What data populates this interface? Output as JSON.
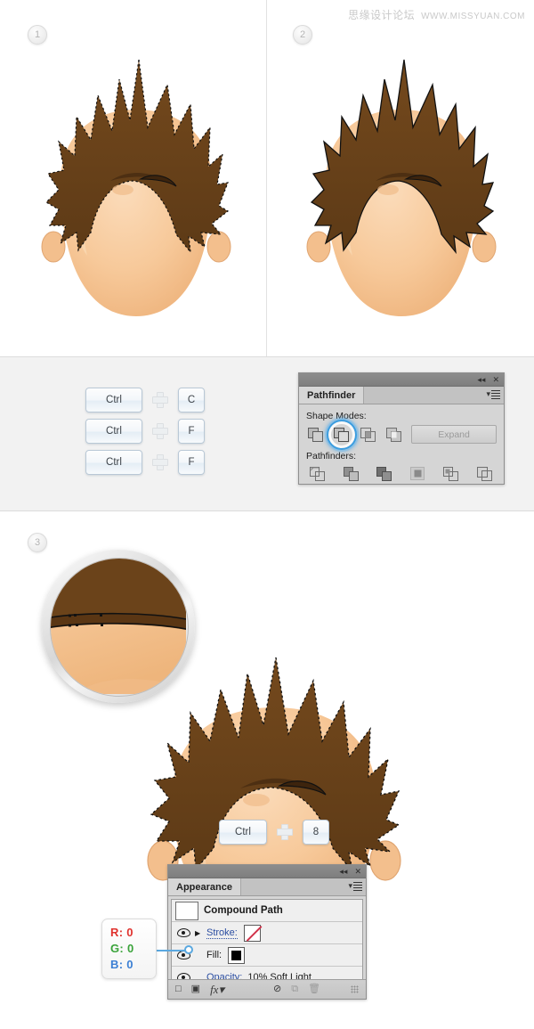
{
  "watermark": {
    "cn": "思缘设计论坛",
    "en": "WWW.MISSYUAN.COM"
  },
  "steps": [
    {
      "id": "1",
      "label": "1"
    },
    {
      "id": "2",
      "label": "2"
    },
    {
      "id": "3",
      "label": "3"
    }
  ],
  "shortcuts": [
    {
      "modifier": "Ctrl",
      "plus": "+",
      "key": "C"
    },
    {
      "modifier": "Ctrl",
      "plus": "+",
      "key": "F"
    },
    {
      "modifier": "Ctrl",
      "plus": "+",
      "key": "F"
    }
  ],
  "shortcut_bottom": {
    "modifier": "Ctrl",
    "plus": "+",
    "key": "8"
  },
  "pathfinder": {
    "tab": "Pathfinder",
    "shape_modes_label": "Shape Modes:",
    "pathfinders_label": "Pathfinders:",
    "expand_label": "Expand",
    "collapse_icon": "collapse-icon",
    "close_icon": "close-icon",
    "menu_icon": "panel-menu-icon",
    "shape_modes": [
      {
        "name": "unite",
        "selected": false
      },
      {
        "name": "minus-front",
        "selected": true
      },
      {
        "name": "intersect",
        "selected": false
      },
      {
        "name": "exclude",
        "selected": false
      }
    ],
    "pathfinder_modes": [
      {
        "name": "divide"
      },
      {
        "name": "trim"
      },
      {
        "name": "merge"
      },
      {
        "name": "crop"
      },
      {
        "name": "outline"
      },
      {
        "name": "minus-back"
      }
    ]
  },
  "appearance": {
    "tab": "Appearance",
    "collapse_icon": "collapse-icon",
    "close_icon": "close-icon",
    "menu_icon": "panel-menu-icon",
    "object_title": "Compound Path",
    "rows": [
      {
        "label": "Stroke:",
        "value": "",
        "swatch": "none",
        "has_eye": true,
        "has_arrow": true
      },
      {
        "label": "Fill:",
        "value": "",
        "swatch": "black",
        "has_eye": true,
        "has_arrow": false
      },
      {
        "label": "Opacity:",
        "value": "10% Soft Light",
        "swatch": "",
        "has_eye": true,
        "has_arrow": false
      }
    ],
    "footer_icons": [
      "new-stroke-icon",
      "new-fill-icon",
      "fx-icon",
      "clear-appearance-icon",
      "duplicate-item-icon",
      "delete-item-icon",
      "resize-grip"
    ]
  },
  "rgb_callout": {
    "r_label": "R:",
    "r_value": "0",
    "g_label": "G:",
    "g_value": "0",
    "b_label": "B:",
    "b_value": "0",
    "r_color": "#e0322e",
    "g_color": "#3aa33a",
    "b_color": "#3b7fd4"
  },
  "artwork": {
    "hair_color": "#6b431a",
    "hair_shadow": "#5a3614",
    "skin_color": "#f6c896",
    "skin_shadow": "#edb77f",
    "outline_color": "#111111",
    "panel1_alt": "cartoon head with spiky brown hair, paths selected",
    "panel2_alt": "cartoon head with spiky brown hair after pathfinder minus front",
    "panel3_alt": "cartoon head with spiky brown hair, compound path applied",
    "magnifier_alt": "zoomed detail of hair and forehead boundary with anchor points"
  }
}
